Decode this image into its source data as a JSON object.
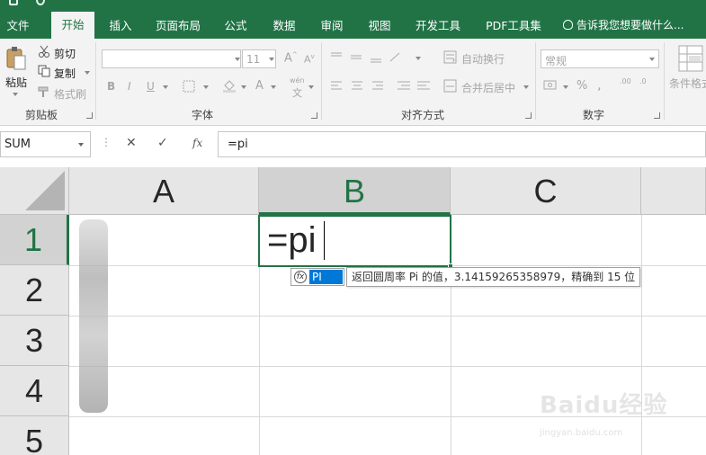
{
  "ribbon": {
    "tabs": [
      {
        "label": "文件",
        "active": false
      },
      {
        "label": "开始",
        "active": true
      },
      {
        "label": "插入",
        "active": false
      },
      {
        "label": "页面布局",
        "active": false
      },
      {
        "label": "公式",
        "active": false
      },
      {
        "label": "数据",
        "active": false
      },
      {
        "label": "审阅",
        "active": false
      },
      {
        "label": "视图",
        "active": false
      },
      {
        "label": "开发工具",
        "active": false
      },
      {
        "label": "PDF工具集",
        "active": false
      }
    ],
    "tell_me": "告诉我您想要做什么...",
    "clipboard": {
      "paste": "粘贴",
      "cut": "剪切",
      "copy": "复制",
      "format_painter": "格式刷",
      "group_label": "剪贴板"
    },
    "font": {
      "size": "11",
      "bold": "B",
      "italic": "I",
      "underline": "U",
      "wen": "wén",
      "group_label": "字体"
    },
    "alignment": {
      "wrap_text": "自动换行",
      "merge_center": "合并后居中",
      "group_label": "对齐方式"
    },
    "number": {
      "format": "常规",
      "percent": "%",
      "comma": ",",
      "inc_decimal": ".00",
      "dec_decimal": ".0",
      "group_label": "数字"
    },
    "styles": {
      "conditional_format": "条件格式"
    }
  },
  "formula_bar": {
    "name_box": "SUM",
    "cancel": "✕",
    "enter": "✓",
    "fx": "fx",
    "formula": "=pi"
  },
  "grid": {
    "columns": [
      "A",
      "B",
      "C"
    ],
    "rows": [
      "1",
      "2",
      "3",
      "4",
      "5"
    ],
    "active_cell": {
      "address": "B1",
      "value": "=pi"
    }
  },
  "autocomplete": {
    "item": "PI",
    "tooltip": "返回圆周率 Pi 的值，3.14159265358979，精确到 15 位"
  },
  "watermark": {
    "brand": "Baidu经验",
    "url": "jingyan.baidu.com"
  },
  "colors": {
    "excel_green": "#217346",
    "highlight_blue": "#0078d7",
    "ribbon_bg": "#f3f3f3",
    "header_bg": "#e6e6e6"
  }
}
